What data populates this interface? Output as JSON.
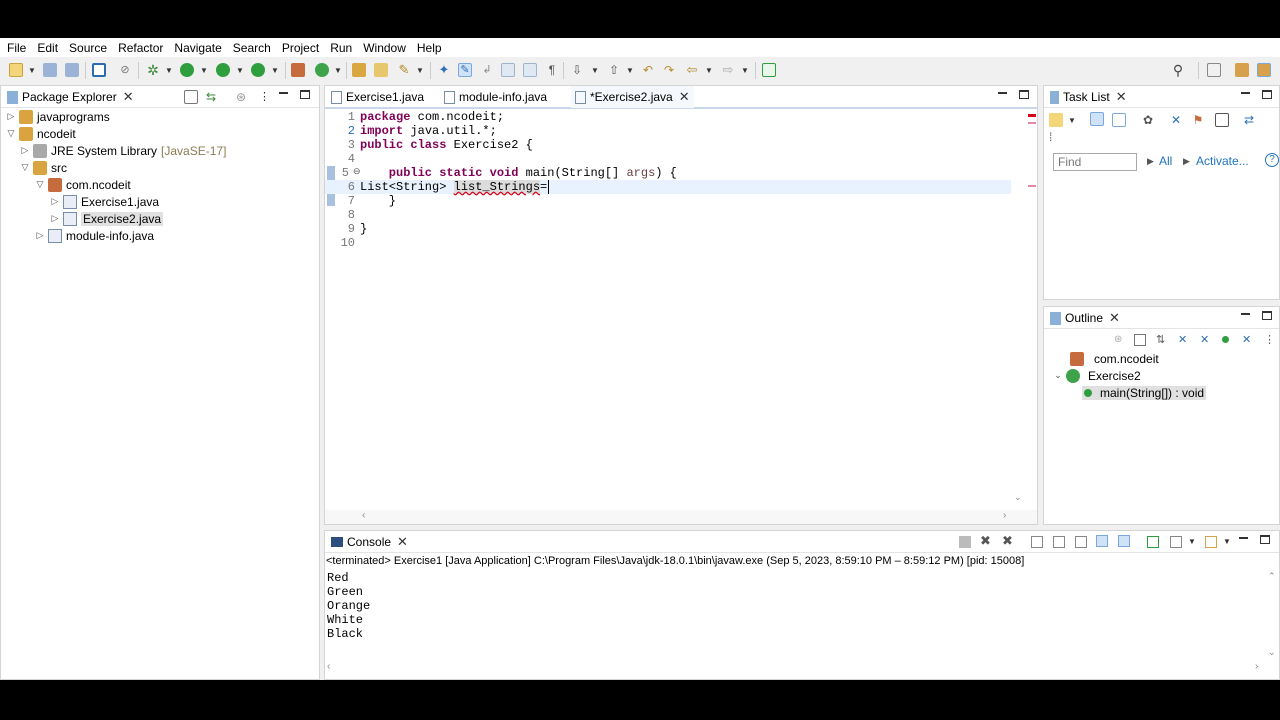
{
  "menu": [
    "File",
    "Edit",
    "Source",
    "Refactor",
    "Navigate",
    "Search",
    "Project",
    "Run",
    "Window",
    "Help"
  ],
  "package_explorer": {
    "title": "Package Explorer",
    "items": [
      {
        "label": "javaprograms",
        "extra": ""
      },
      {
        "label": "ncodeit",
        "extra": ""
      },
      {
        "label": "JRE System Library",
        "extra": "[JavaSE-17]"
      },
      {
        "label": "src",
        "extra": ""
      },
      {
        "label": "com.ncodeit",
        "extra": ""
      },
      {
        "label": "Exercise1.java",
        "extra": ""
      },
      {
        "label": "Exercise2.java",
        "extra": ""
      },
      {
        "label": "module-info.java",
        "extra": ""
      }
    ]
  },
  "editor": {
    "tabs": [
      "Exercise1.java",
      "module-info.java",
      "*Exercise2.java"
    ],
    "lines": [
      {
        "num": "1",
        "kw": "package",
        "rest": " com.ncodeit;"
      },
      {
        "num": "2",
        "kw": "import",
        "rest": " java.util.*;"
      },
      {
        "num": "3",
        "kw": "public class",
        "rest": " Exercise2 {"
      },
      {
        "num": "4",
        "kw": "",
        "rest": ""
      },
      {
        "num": "5",
        "kw": "    public static void",
        "rest": " main(String[] ",
        "param": "args",
        "tail": ") {"
      },
      {
        "num": "6",
        "kw": "",
        "rest": "List<String> ",
        "err": "list_Strings",
        "tail": "="
      },
      {
        "num": "7",
        "kw": "",
        "rest": "    }"
      },
      {
        "num": "8",
        "kw": "",
        "rest": ""
      },
      {
        "num": "9",
        "kw": "",
        "rest": "}"
      },
      {
        "num": "10",
        "kw": "",
        "rest": ""
      }
    ]
  },
  "task_list": {
    "title": "Task List",
    "find_placeholder": "Find",
    "all_label": "All",
    "activate_label": "Activate..."
  },
  "outline": {
    "title": "Outline",
    "items": [
      "com.ncodeit",
      "Exercise2",
      "main(String[]) : void"
    ]
  },
  "console": {
    "title": "Console",
    "status": "<terminated> Exercise1 [Java Application] C:\\Program Files\\Java\\jdk-18.0.1\\bin\\javaw.exe  (Sep 5, 2023, 8:59:10 PM – 8:59:12 PM) [pid: 15008]",
    "output": [
      "Red",
      "Green",
      "Orange",
      "White",
      "Black"
    ]
  },
  "colors": {
    "keyword": "#7f0055",
    "error": "#d9001b",
    "accent": "#1e73be"
  }
}
